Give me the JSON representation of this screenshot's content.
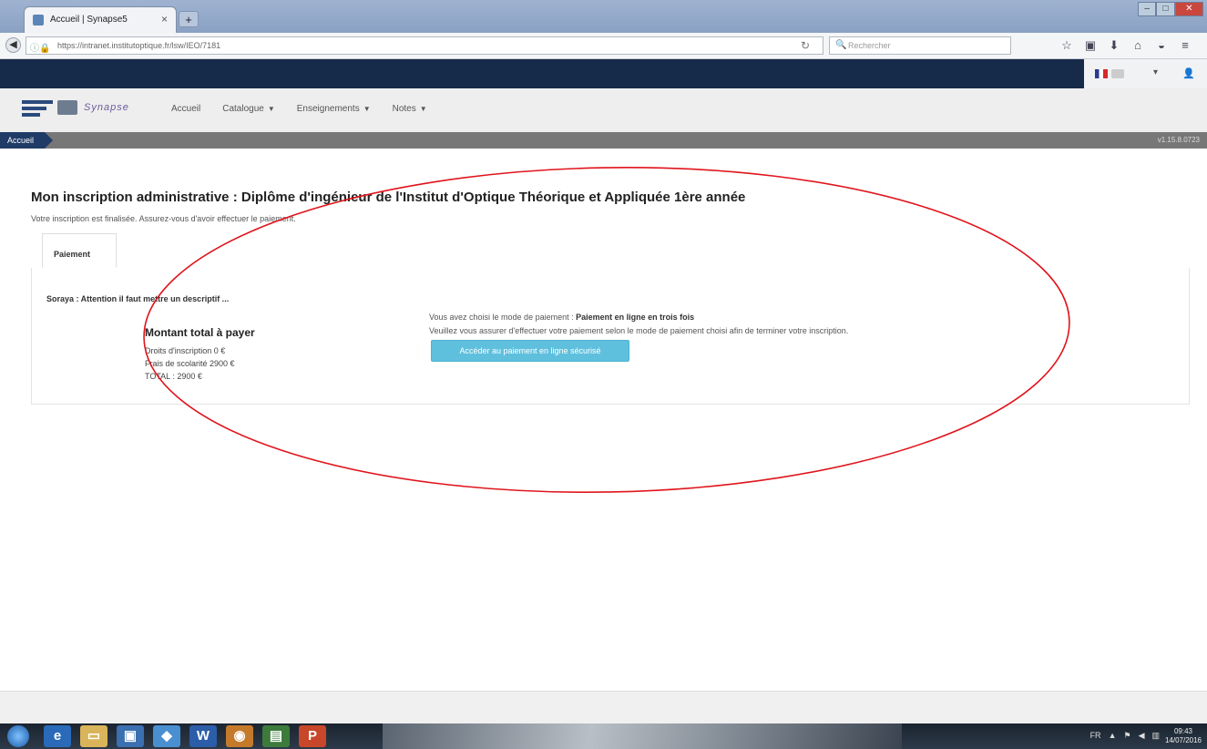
{
  "browser": {
    "tab_title": "Accueil | Synapse5",
    "tab_close": "×",
    "new_tab": "+",
    "url": "https://intranet.institutoptique.fr/lsw/IEO/7181",
    "search_placeholder": "Rechercher",
    "window_controls": [
      "–",
      "□",
      "✕"
    ]
  },
  "site": {
    "logo_text": "Synapse",
    "menu": [
      {
        "label": "Accueil",
        "dropdown": false
      },
      {
        "label": "Catalogue",
        "dropdown": true
      },
      {
        "label": "Enseignements",
        "dropdown": true
      },
      {
        "label": "Notes",
        "dropdown": true
      }
    ],
    "breadcrumb": "Accueil",
    "version": "v1.15.8.0723"
  },
  "page": {
    "title": "Mon inscription administrative : Diplôme d'ingénieur de l'Institut d'Optique Théorique et Appliquée 1ère année",
    "subtitle": "Votre inscription est finalisée. Assurez-vous d'avoir effectuer le paiement.",
    "tab_label": "Paiement",
    "note": "Soraya : Attention il faut mettre un descriptif ...",
    "total_title": "Montant total à payer",
    "fees": [
      "Droits d'inscription 0 €",
      "Frais de scolarité 2900 €",
      "TOTAL : 2900 €"
    ],
    "pay_mode_prefix": "Vous avez choisi le mode de paiement :",
    "pay_mode_value": "Paiement en ligne en trois fois",
    "pay_instructions": "Veuillez vous assurer d'effectuer votre paiement selon le mode de paiement choisi afin de terminer votre inscription.",
    "pay_button": "Accéder au paiement en ligne sécurisé"
  },
  "taskbar": {
    "tray_lang": "FR",
    "clock_time": "09:43",
    "clock_date": "14/07/2016"
  },
  "colors": {
    "header_dark": "#162b49",
    "button": "#5fc0de",
    "annotation": "#e0141c"
  }
}
